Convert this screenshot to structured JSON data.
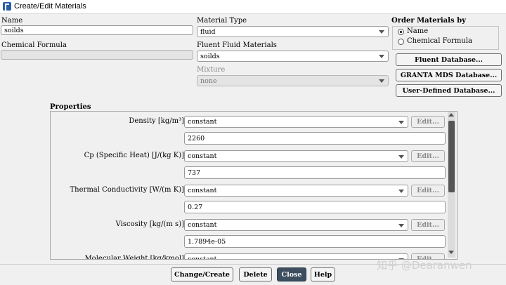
{
  "window": {
    "title": "Create/Edit Materials"
  },
  "name": {
    "label": "Name",
    "value": "soilds"
  },
  "chemical_formula": {
    "label": "Chemical Formula",
    "value": ""
  },
  "material_type": {
    "label": "Material Type",
    "value": "fluid"
  },
  "fluent_materials": {
    "label": "Fluent Fluid Materials",
    "value": "soilds"
  },
  "mixture": {
    "label": "Mixture",
    "value": "none"
  },
  "order_by": {
    "label": "Order Materials by",
    "options": [
      {
        "label": "Name",
        "selected": true
      },
      {
        "label": "Chemical Formula",
        "selected": false
      }
    ]
  },
  "database_buttons": {
    "fluent": "Fluent Database...",
    "granta": "GRANTA MDS Database...",
    "user_defined": "User-Defined Database..."
  },
  "properties": {
    "label": "Properties",
    "rows": [
      {
        "label": "Density [kg/m³]",
        "method": "constant",
        "edit": "Edit...",
        "value": "2260"
      },
      {
        "label": "Cp (Specific Heat) [J/(kg K)]",
        "method": "constant",
        "edit": "Edit...",
        "value": "737"
      },
      {
        "label": "Thermal Conductivity [W/(m K)]",
        "method": "constant",
        "edit": "Edit...",
        "value": "0.27"
      },
      {
        "label": "Viscosity [kg/(m s)]",
        "method": "constant",
        "edit": "Edit...",
        "value": "1.7894e-05"
      },
      {
        "label": "Molecular Weight [kg/kmol]",
        "method": "constant",
        "edit": "Edit..."
      }
    ]
  },
  "actions": {
    "change_create": "Change/Create",
    "delete": "Delete",
    "close": "Close",
    "help": "Help"
  },
  "watermark": "知乎 @Dearanwen",
  "colors": {
    "close_button": "#3d4f5f",
    "scrollbar_thumb": "#555555"
  }
}
